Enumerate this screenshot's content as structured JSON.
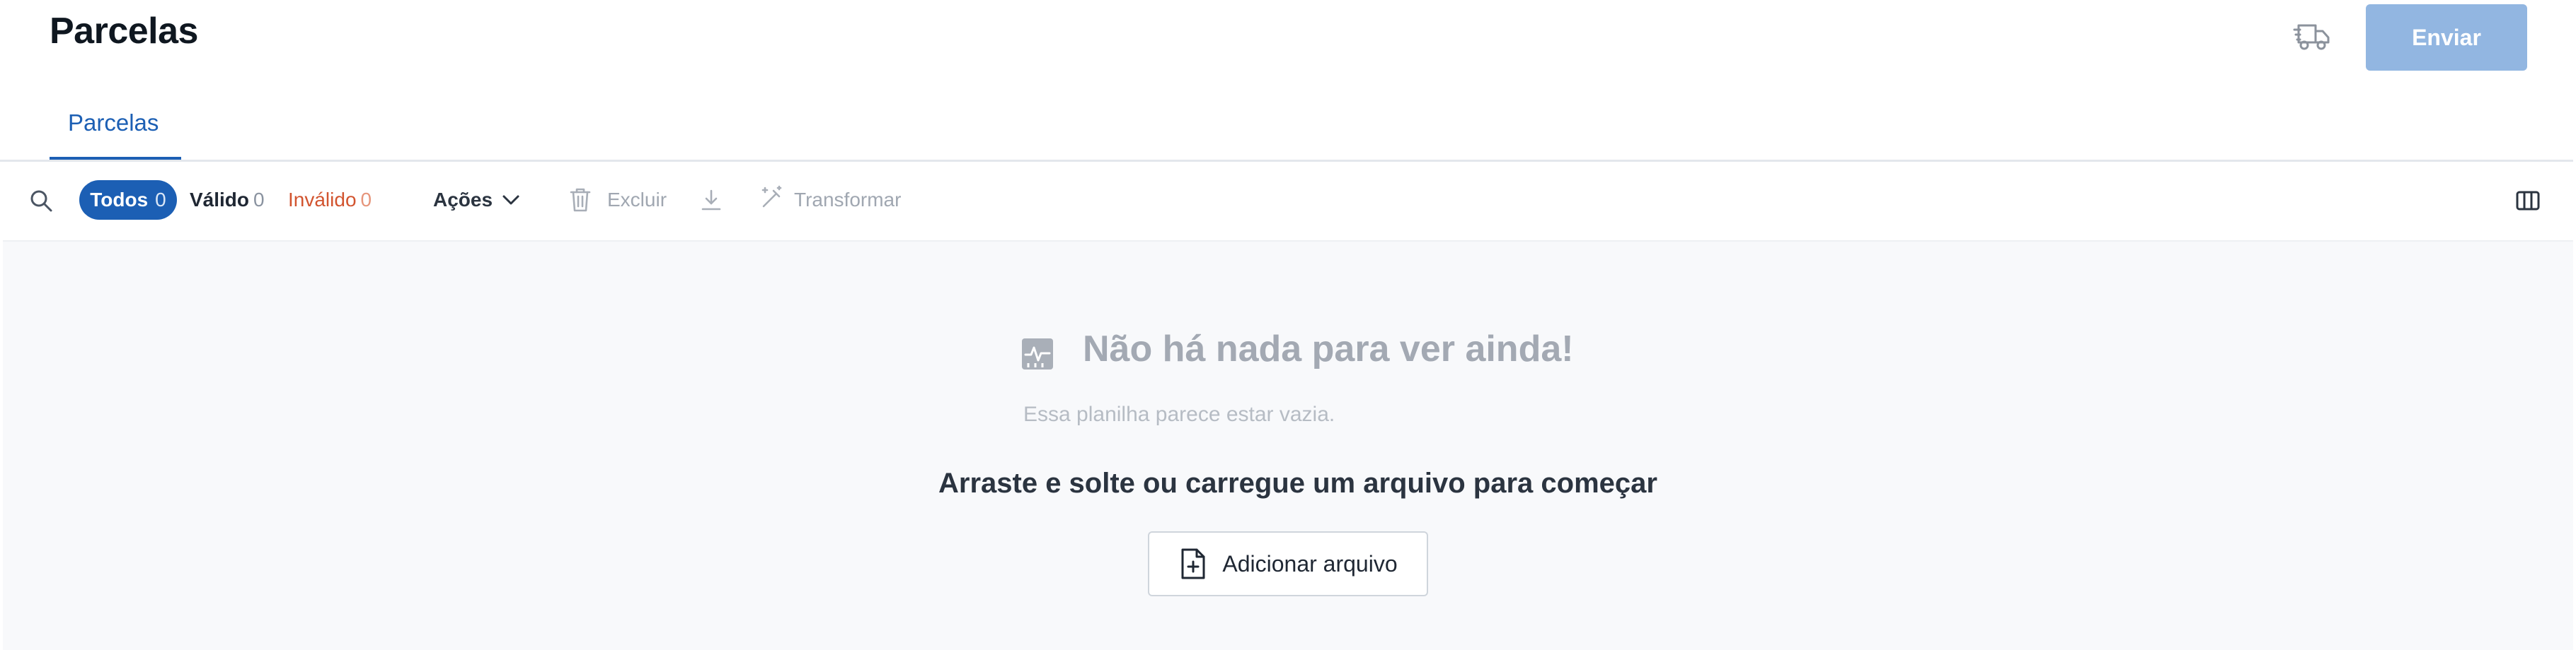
{
  "header": {
    "title": "Parcelas",
    "truck_icon": "truck-icon",
    "send_label": "Enviar"
  },
  "tabs": [
    {
      "label": "Parcelas",
      "active": true
    }
  ],
  "toolbar": {
    "search_icon": "search-icon",
    "filters": {
      "all_label": "Todos",
      "all_count": "0",
      "valid_label": "Válido",
      "valid_count": "0",
      "invalid_label": "Inválido",
      "invalid_count": "0"
    },
    "actions_label": "Ações",
    "delete_label": "Excluir",
    "transform_label": "Transformar",
    "icons": [
      "trash-icon",
      "download-icon",
      "magic-wand-icon",
      "columns-icon"
    ]
  },
  "empty_state": {
    "title": "Não há nada para ver ainda!",
    "subtitle": "Essa planilha parece estar vazia.",
    "prompt": "Arraste e solte ou carregue um arquivo para começar",
    "add_file_label": "Adicionar arquivo"
  },
  "colors": {
    "accent": "#1c5fb4",
    "send_disabled": "#92b6e1",
    "invalid": "#d2542f",
    "empty_bg": "#f8f9fb"
  }
}
